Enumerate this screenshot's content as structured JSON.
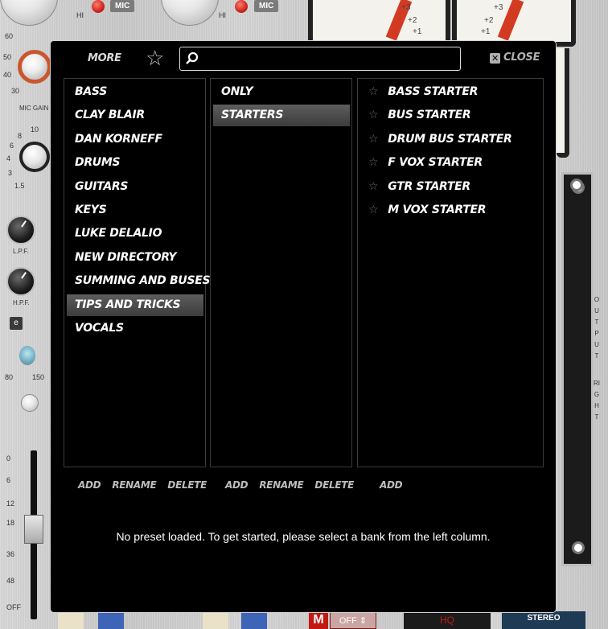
{
  "background": {
    "mic_badge": "MIC",
    "hi_label": "HI",
    "mic_gain_label": "MIC GAIN",
    "lpf_label": "L.P.F.",
    "hpf_label": "H.P.F.",
    "e_button": "e",
    "hp_low": "80",
    "hp_high": "150",
    "output_label": "OUTPUT",
    "right_label": "RIGHT",
    "fader_scale": [
      "0",
      "6",
      "12",
      "18",
      "36",
      "48",
      "OFF"
    ],
    "meter_scale": [
      "+3",
      "+2",
      "+1"
    ],
    "gain_scale": [
      "60",
      "50",
      "40",
      "30"
    ],
    "knob2_scale": [
      "10",
      "8",
      "6",
      "4",
      "3",
      "1.5"
    ],
    "bottom_m": "M",
    "bottom_off": "OFF",
    "bottom_hq": "HQ",
    "bottom_stereo": "STEREO",
    "accent_red": "#c21a12",
    "accent_orange": "#c9572c"
  },
  "dialog": {
    "more_label": "MORE",
    "search": {
      "value": "",
      "placeholder": ""
    },
    "close_label": "CLOSE",
    "banks": [
      {
        "label": "BASS",
        "selected": false
      },
      {
        "label": "CLAY BLAIR",
        "selected": false
      },
      {
        "label": "DAN KORNEFF",
        "selected": false
      },
      {
        "label": "DRUMS",
        "selected": false
      },
      {
        "label": "GUITARS",
        "selected": false
      },
      {
        "label": "KEYS",
        "selected": false
      },
      {
        "label": "LUKE DELALIO",
        "selected": false
      },
      {
        "label": "NEW DIRECTORY",
        "selected": false
      },
      {
        "label": "SUMMING AND BUSES",
        "selected": false
      },
      {
        "label": "TIPS AND TRICKS",
        "selected": true
      },
      {
        "label": "VOCALS",
        "selected": false
      }
    ],
    "folders": [
      {
        "label": "ONLY",
        "selected": false
      },
      {
        "label": "STARTERS",
        "selected": true
      }
    ],
    "presets": [
      {
        "label": "BASS STARTER"
      },
      {
        "label": "BUS STARTER"
      },
      {
        "label": "DRUM BUS STARTER"
      },
      {
        "label": "F VOX STARTER"
      },
      {
        "label": "GTR STARTER"
      },
      {
        "label": "M VOX STARTER"
      }
    ],
    "col1_actions": {
      "add": "ADD",
      "rename": "RENAME",
      "delete": "DELETE"
    },
    "col2_actions": {
      "add": "ADD",
      "rename": "RENAME",
      "delete": "DELETE"
    },
    "col3_actions": {
      "add": "ADD"
    },
    "status": "No preset loaded. To get started, please select a bank from the left column."
  }
}
